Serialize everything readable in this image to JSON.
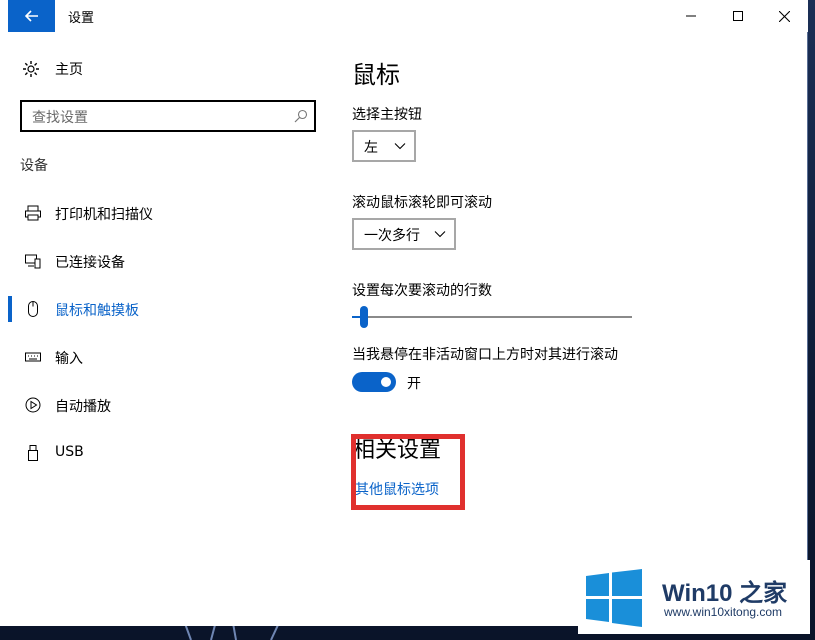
{
  "window": {
    "title": "设置",
    "controls": {
      "minimize": "minimize-icon",
      "maximize": "maximize-icon",
      "close": "close-icon"
    }
  },
  "sidebar": {
    "home_label": "主页",
    "search_placeholder": "查找设置",
    "section_label": "设备",
    "items": [
      {
        "label": "打印机和扫描仪",
        "icon": "printer-icon",
        "active": false
      },
      {
        "label": "已连接设备",
        "icon": "connected-devices-icon",
        "active": false
      },
      {
        "label": "鼠标和触摸板",
        "icon": "mouse-icon",
        "active": true
      },
      {
        "label": "输入",
        "icon": "keyboard-icon",
        "active": false
      },
      {
        "label": "自动播放",
        "icon": "autoplay-icon",
        "active": false
      },
      {
        "label": "USB",
        "icon": "usb-icon",
        "active": false
      }
    ]
  },
  "main": {
    "title": "鼠标",
    "primary_button": {
      "label": "选择主按钮",
      "value": "左"
    },
    "scroll_wheel": {
      "label": "滚动鼠标滚轮即可滚动",
      "value": "一次多行"
    },
    "scroll_lines": {
      "label": "设置每次要滚动的行数",
      "value_fraction": 0.03
    },
    "inactive_scroll": {
      "label": "当我悬停在非活动窗口上方时对其进行滚动",
      "state": "开",
      "on": true
    },
    "related": {
      "title": "相关设置",
      "link": "其他鼠标选项"
    }
  },
  "watermark": {
    "brand": "Win10 之家",
    "url": "www.win10xitong.com"
  },
  "colors": {
    "accent": "#0a63c9",
    "highlight": "#e0302e"
  }
}
